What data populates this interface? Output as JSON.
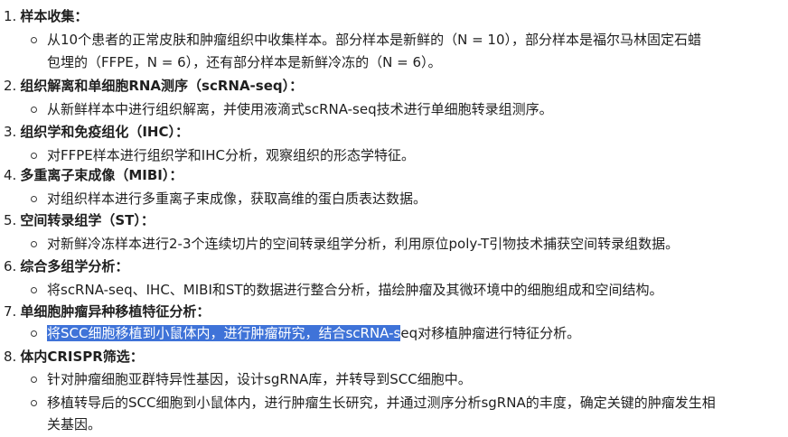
{
  "items": [
    {
      "num": "1.",
      "title": "样本收集：",
      "bullets": [
        "从10个患者的正常皮肤和肿瘤组织中收集样本。部分样本是新鲜的（N = 10），部分样本是福尔马林固定石蜡",
        "包埋的（FFPE，N = 6），还有部分样本是新鲜冷冻的（N = 6）。"
      ]
    },
    {
      "num": "2.",
      "title": "组织解离和单细胞RNA测序（scRNA-seq）：",
      "bullets": [
        "从新鲜样本中进行组织解离，并使用液滴式scRNA-seq技术进行单细胞转录组测序。"
      ]
    },
    {
      "num": "3.",
      "title": "组织学和免疫组化（IHC）：",
      "bullets": [
        "对FFPE样本进行组织学和IHC分析，观察组织的形态学特征。"
      ]
    },
    {
      "num": "4.",
      "title": "多重离子束成像（MIBI）：",
      "bullets": [
        "对组织样本进行多重离子束成像，获取高维的蛋白质表达数据。"
      ]
    },
    {
      "num": "5.",
      "title": "空间转录组学（ST）：",
      "bullets": [
        "对新鲜冷冻样本进行2-3个连续切片的空间转录组学分析，利用原位poly-T引物技术捕获空间转录组数据。"
      ]
    },
    {
      "num": "6.",
      "title": "综合多组学分析：",
      "bullets": [
        "将scRNA-seq、IHC、MIBI和ST的数据进行整合分析，描绘肿瘤及其微环境中的细胞组成和空间结构。"
      ]
    },
    {
      "num": "7.",
      "title": "单细胞肿瘤异种移植特征分析：",
      "bullets_split": {
        "selected": "将SCC细胞移植到小鼠体内，进行肿瘤研究，结合scRNA-s",
        "rest": "eq对移植肿瘤进行特征分析。"
      }
    },
    {
      "num": "8.",
      "title": "体内CRISPR筛选：",
      "bullets": [
        "针对肿瘤细胞亚群特异性基因，设计sgRNA库，并转导到SCC细胞中。",
        "移植转导后的SCC细胞到小鼠体内，进行肿瘤生长研究，并通过测序分析sgRNA的丰度，确定关键的肿瘤发生相",
        "关基因。"
      ]
    }
  ],
  "colors": {
    "text": "#1f1f1f",
    "selection_bg": "#3f73d8",
    "selection_text": "#ffffff"
  }
}
